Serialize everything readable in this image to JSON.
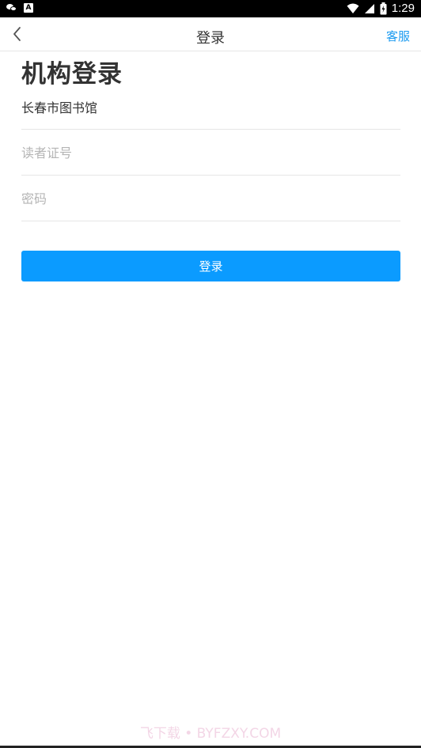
{
  "status_bar": {
    "time": "1:29",
    "left_icons": [
      "wechat-icon",
      "a-icon"
    ],
    "right_icons": [
      "wifi-icon",
      "signal-icon",
      "battery-icon"
    ]
  },
  "header": {
    "title": "登录",
    "back_icon": "chevron-left-icon",
    "service_label": "客服"
  },
  "page": {
    "heading": "机构登录"
  },
  "form": {
    "library_value": "长春市图书馆",
    "card_placeholder": "读者证号",
    "password_placeholder": "密码",
    "submit_label": "登录"
  },
  "watermark": {
    "text": "飞下载 • BYFZXY.COM"
  },
  "colors": {
    "accent": "#0b9bff",
    "link": "#1a9af0",
    "divider": "#e6e6e6",
    "placeholder": "#b5b5b5"
  }
}
